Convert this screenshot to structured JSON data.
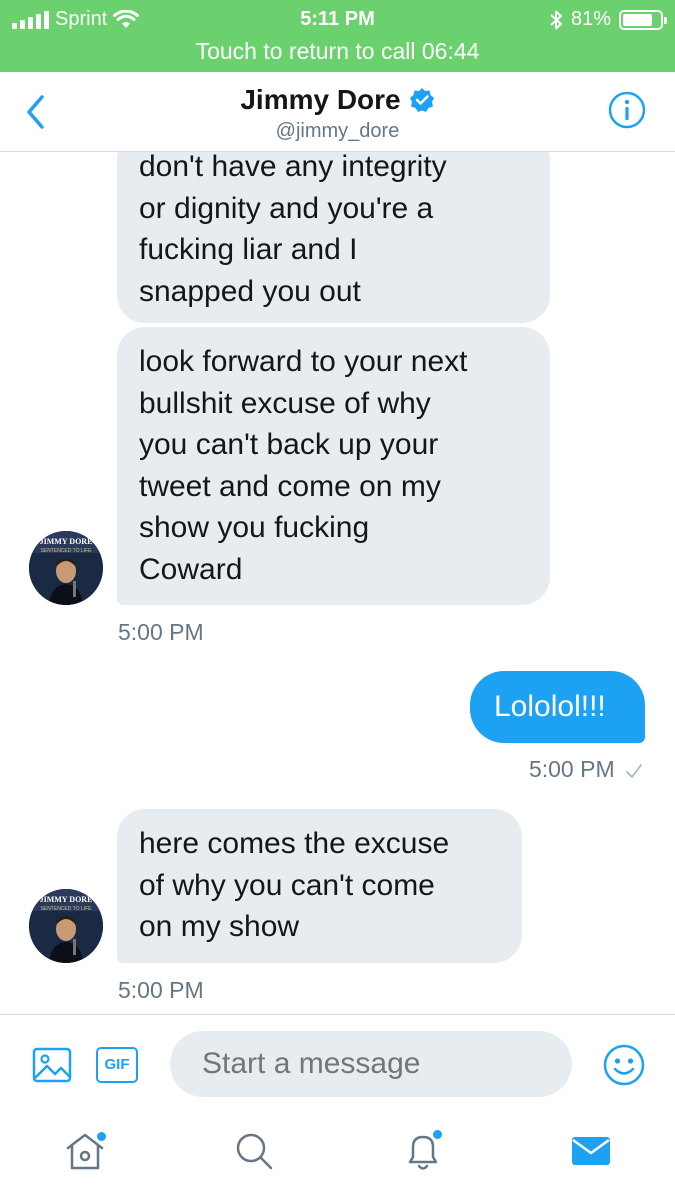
{
  "status_bar": {
    "carrier": "Sprint",
    "time": "5:11 PM",
    "battery": "81%",
    "battery_level": 0.81,
    "return_to_call": "Touch to return to call 06:44"
  },
  "header": {
    "name": "Jimmy Dore",
    "handle": "@jimmy_dore",
    "verified": true
  },
  "messages": [
    {
      "direction": "incoming",
      "lines": [
        "don't have any integrity",
        "or dignity and you're a",
        "fucking liar and I",
        "snapped you out"
      ]
    },
    {
      "direction": "incoming",
      "lines": [
        "look forward to your next",
        "bullshit excuse of why",
        "you can't back up your",
        "tweet and come on my",
        "show you fucking",
        "Coward"
      ],
      "timestamp": "5:00 PM"
    },
    {
      "direction": "outgoing",
      "lines": [
        "Lololol!!!"
      ],
      "timestamp": "5:00 PM",
      "status_icon": "checkmark-icon"
    },
    {
      "direction": "incoming",
      "lines": [
        "here comes the excuse",
        "of why you can't come",
        "on my show"
      ],
      "timestamp": "5:00 PM"
    }
  ],
  "avatar": {
    "caption_top": "JIMMY DORE",
    "caption_bottom": "SENTENCED TO LIFE"
  },
  "composer": {
    "placeholder": "Start a message",
    "gif_label": "GIF"
  },
  "tabs": [
    {
      "name": "home",
      "icon": "home-icon",
      "has_dot": true
    },
    {
      "name": "search",
      "icon": "search-icon",
      "has_dot": false
    },
    {
      "name": "notifications",
      "icon": "bell-icon",
      "has_dot": true
    },
    {
      "name": "messages",
      "icon": "envelope-icon",
      "has_dot": false,
      "active": true
    }
  ],
  "colors": {
    "status_bar": "#6bd16e",
    "accent": "#1da1f2",
    "bubble_incoming": "#e6ecf0",
    "text_secondary": "#657786"
  }
}
